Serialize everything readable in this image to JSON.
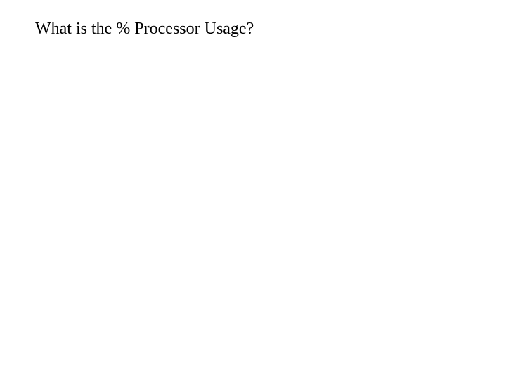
{
  "question": {
    "text": "What is the % Processor Usage?"
  }
}
